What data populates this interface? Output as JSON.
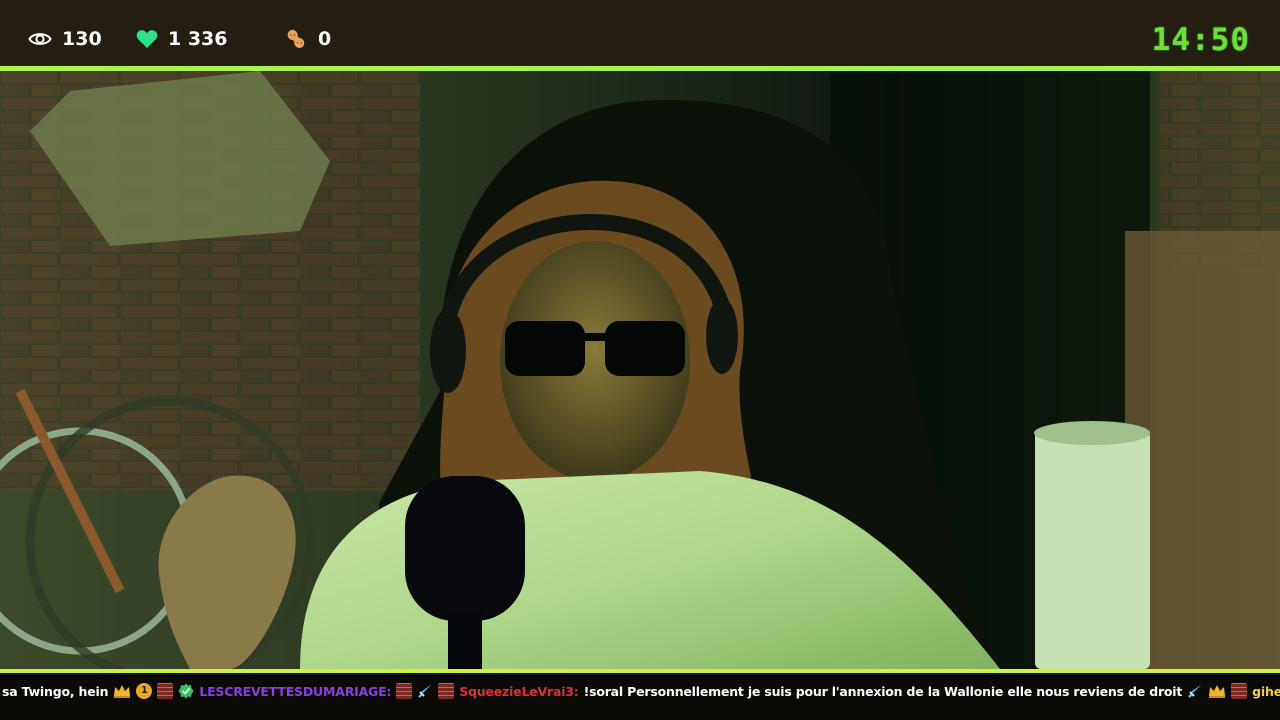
{
  "stats": {
    "viewers": "130",
    "likes": "1 336",
    "bits": "0"
  },
  "clock": "14:50",
  "icons": {
    "viewers": "eye-icon",
    "likes": "heart-icon",
    "bits": "peanut-icon"
  },
  "colors": {
    "topbar_bg": "#231d12",
    "accent_line": "#a4f44a",
    "clock": "#6ee03c",
    "heart": "#2fe08a",
    "ticker_line": "#d2ef3a"
  },
  "ticker": {
    "segment_1": "sa Twingo, hein",
    "badge_number": "1",
    "user_1": "LESCREVETTESDUMARIAGE:",
    "user_2": "SqueezieLeVrai3:",
    "message_2": "!soral Personnellement je suis pour l'annexion de la Wallonie elle nous reviens de droit",
    "user_3": "gihel:"
  }
}
